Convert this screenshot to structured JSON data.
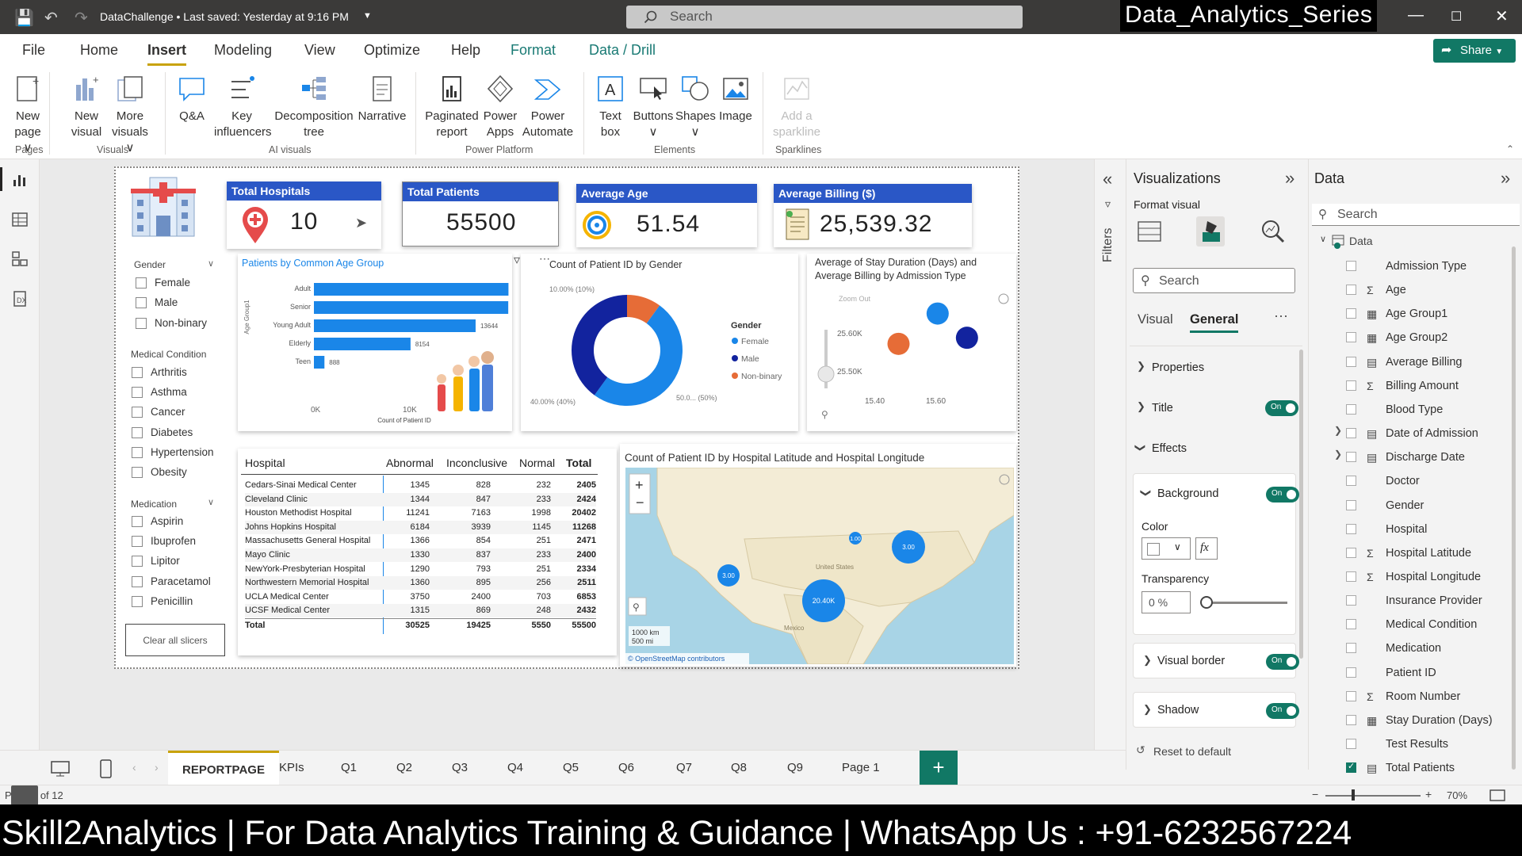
{
  "titlebar": {
    "doc_title": "DataChallenge • Last saved: Yesterday at 9:16 PM",
    "search_placeholder": "Search",
    "series_label": "Data_Analytics_Series"
  },
  "menu": {
    "tabs": [
      "File",
      "Home",
      "Insert",
      "Modeling",
      "View",
      "Optimize",
      "Help",
      "Format",
      "Data / Drill"
    ],
    "active": "Insert",
    "share_label": "Share"
  },
  "ribbon": {
    "items": [
      {
        "l1": "New",
        "l2": "page ∨"
      },
      {
        "l1": "New",
        "l2": "visual"
      },
      {
        "l1": "More",
        "l2": "visuals ∨"
      },
      {
        "l1": "Q&A",
        "l2": ""
      },
      {
        "l1": "Key",
        "l2": "influencers"
      },
      {
        "l1": "Decomposition",
        "l2": "tree"
      },
      {
        "l1": "Narrative",
        "l2": ""
      },
      {
        "l1": "Paginated",
        "l2": "report"
      },
      {
        "l1": "Power",
        "l2": "Apps"
      },
      {
        "l1": "Power",
        "l2": "Automate"
      },
      {
        "l1": "Text",
        "l2": "box"
      },
      {
        "l1": "Buttons",
        "l2": "∨"
      },
      {
        "l1": "Shapes",
        "l2": "∨"
      },
      {
        "l1": "Image",
        "l2": ""
      },
      {
        "l1": "Add a",
        "l2": "sparkline"
      }
    ],
    "groups": [
      "Pages",
      "Visuals",
      "AI visuals",
      "Power Platform",
      "Elements",
      "Sparklines"
    ]
  },
  "kpis": {
    "total_hospitals": {
      "label": "Total Hospitals",
      "value": "10"
    },
    "total_patients": {
      "label": "Total Patients",
      "value": "55500"
    },
    "average_age": {
      "label": "Average Age",
      "value": "51.54"
    },
    "average_billing": {
      "label": "Average Billing ($)",
      "value": "25,539.32"
    }
  },
  "slicers": {
    "gender": {
      "title": "Gender",
      "items": [
        "Female",
        "Male",
        "Non-binary"
      ]
    },
    "medical_condition": {
      "title": "Medical Condition",
      "items": [
        "Arthritis",
        "Asthma",
        "Cancer",
        "Diabetes",
        "Hypertension",
        "Obesity"
      ]
    },
    "medication": {
      "title": "Medication",
      "items": [
        "Aspirin",
        "Ibuprofen",
        "Lipitor",
        "Paracetamol",
        "Penicillin"
      ]
    },
    "clear_label": "Clear all slicers"
  },
  "chart_data": [
    {
      "type": "bar",
      "title": "Patients by Common Age Group",
      "categories": [
        "Adult",
        "Senior",
        "Young Adult",
        "Elderly",
        "Teen"
      ],
      "values": [
        16416,
        16398,
        13644,
        8154,
        888
      ],
      "ylabel": "Age Group1",
      "xlabel": "Count of Patient ID",
      "x_ticks": [
        "0K",
        "10K"
      ],
      "xlim": [
        0,
        20000
      ],
      "color": "#1a86e8"
    },
    {
      "type": "pie",
      "title": "Count of Patient ID by Gender",
      "legend_title": "Gender",
      "categories": [
        "Female",
        "Male",
        "Non-binary"
      ],
      "values": [
        50,
        40,
        10
      ],
      "labels": [
        "50.0... (50%)",
        "40.00% (40%)",
        "10.00% (10%)"
      ],
      "colors": [
        "#1a86e8",
        "#12239e",
        "#e66c37"
      ]
    },
    {
      "type": "scatter",
      "title": "Average of Stay Duration (Days) and Average Billing by Admission Type",
      "zoom_label": "Zoom Out",
      "points": [
        {
          "x": 15.52,
          "y": 25.58,
          "color": "#1a86e8"
        },
        {
          "x": 15.44,
          "y": 25.53,
          "color": "#e66c37"
        },
        {
          "x": 15.58,
          "y": 25.54,
          "color": "#12239e"
        }
      ],
      "x_ticks": [
        "15.40",
        "15.60"
      ],
      "y_ticks": [
        "25.60K",
        "25.50K"
      ],
      "xlim": [
        15.35,
        15.65
      ],
      "ylim": [
        25.45,
        25.62
      ]
    },
    {
      "type": "table",
      "title": "Hospital",
      "columns": [
        "Hospital",
        "Abnormal",
        "Inconclusive",
        "Normal",
        "Total"
      ],
      "rows": [
        [
          "Cedars-Sinai Medical Center",
          "1345",
          "828",
          "232",
          "2405"
        ],
        [
          "Cleveland Clinic",
          "1344",
          "847",
          "233",
          "2424"
        ],
        [
          "Houston Methodist Hospital",
          "11241",
          "7163",
          "1998",
          "20402"
        ],
        [
          "Johns Hopkins Hospital",
          "6184",
          "3939",
          "1145",
          "11268"
        ],
        [
          "Massachusetts General Hospital",
          "1366",
          "854",
          "251",
          "2471"
        ],
        [
          "Mayo Clinic",
          "1330",
          "837",
          "233",
          "2400"
        ],
        [
          "NewYork-Presbyterian Hospital",
          "1290",
          "793",
          "251",
          "2334"
        ],
        [
          "Northwestern Memorial Hospital",
          "1360",
          "895",
          "256",
          "2511"
        ],
        [
          "UCLA Medical Center",
          "3750",
          "2400",
          "703",
          "6853"
        ],
        [
          "UCSF Medical Center",
          "1315",
          "869",
          "248",
          "2432"
        ],
        [
          "Total",
          "30525",
          "19425",
          "5550",
          "55500"
        ]
      ]
    }
  ],
  "map": {
    "title": "Count of Patient ID by Hospital Latitude and Hospital Longitude",
    "bubbles": [
      "3.00",
      "20.40K",
      "3.00",
      "1.00"
    ],
    "scale": [
      "1000 km",
      "500 mi"
    ],
    "attribution": "© OpenStreetMap contributors",
    "country_labels": [
      "United States",
      "Mexico"
    ]
  },
  "visualizations": {
    "title": "Visualizations",
    "subtitle": "Format visual",
    "search": "Search",
    "tab_visual": "Visual",
    "tab_general": "General",
    "properties": "Properties",
    "title_sec": "Title",
    "effects": "Effects",
    "background": "Background",
    "color": "Color",
    "transparency": "Transparency",
    "transparency_value": "0 %",
    "visual_border": "Visual border",
    "shadow": "Shadow",
    "reset": "Reset to default",
    "toggle_on": "On"
  },
  "filters_label": "Filters",
  "data_pane": {
    "title": "Data",
    "search": "Search",
    "table": "Data",
    "fields": [
      {
        "name": "Admission Type",
        "icon": "",
        "checked": false
      },
      {
        "name": "Age",
        "icon": "Σ",
        "checked": false
      },
      {
        "name": "Age Group1",
        "icon": "▦",
        "checked": false
      },
      {
        "name": "Age Group2",
        "icon": "▦",
        "checked": false
      },
      {
        "name": "Average Billing",
        "icon": "▤",
        "checked": false
      },
      {
        "name": "Billing Amount",
        "icon": "Σ",
        "checked": false
      },
      {
        "name": "Blood Type",
        "icon": "",
        "checked": false
      },
      {
        "name": "Date of Admission",
        "icon": "▤",
        "checked": false
      },
      {
        "name": "Discharge Date",
        "icon": "▤",
        "checked": false
      },
      {
        "name": "Doctor",
        "icon": "",
        "checked": false
      },
      {
        "name": "Gender",
        "icon": "",
        "checked": false
      },
      {
        "name": "Hospital",
        "icon": "",
        "checked": false
      },
      {
        "name": "Hospital Latitude",
        "icon": "Σ",
        "checked": false
      },
      {
        "name": "Hospital Longitude",
        "icon": "Σ",
        "checked": false
      },
      {
        "name": "Insurance Provider",
        "icon": "",
        "checked": false
      },
      {
        "name": "Medical Condition",
        "icon": "",
        "checked": false
      },
      {
        "name": "Medication",
        "icon": "",
        "checked": false
      },
      {
        "name": "Patient ID",
        "icon": "",
        "checked": false
      },
      {
        "name": "Room Number",
        "icon": "Σ",
        "checked": false
      },
      {
        "name": "Stay Duration (Days)",
        "icon": "▦",
        "checked": false
      },
      {
        "name": "Test Results",
        "icon": "",
        "checked": false
      },
      {
        "name": "Total Patients",
        "icon": "▤",
        "checked": true
      }
    ]
  },
  "pages": {
    "tabs": [
      "REPORTPAGE",
      "KPIs",
      "Q1",
      "Q2",
      "Q3",
      "Q4",
      "Q5",
      "Q6",
      "Q7",
      "Q8",
      "Q9",
      "Page 1"
    ],
    "active": "REPORTPAGE"
  },
  "status": {
    "page": "Page 1 of 12",
    "zoom": "70%"
  },
  "banner": "Skill2Analytics | For Data Analytics Training & Guidance | WhatsApp Us : +91-6232567224",
  "colors": {
    "kpi_header": "#2a57c6",
    "accent": "#117865",
    "bar": "#1a86e8",
    "dark_blue": "#12239e",
    "orange": "#e66c37"
  }
}
